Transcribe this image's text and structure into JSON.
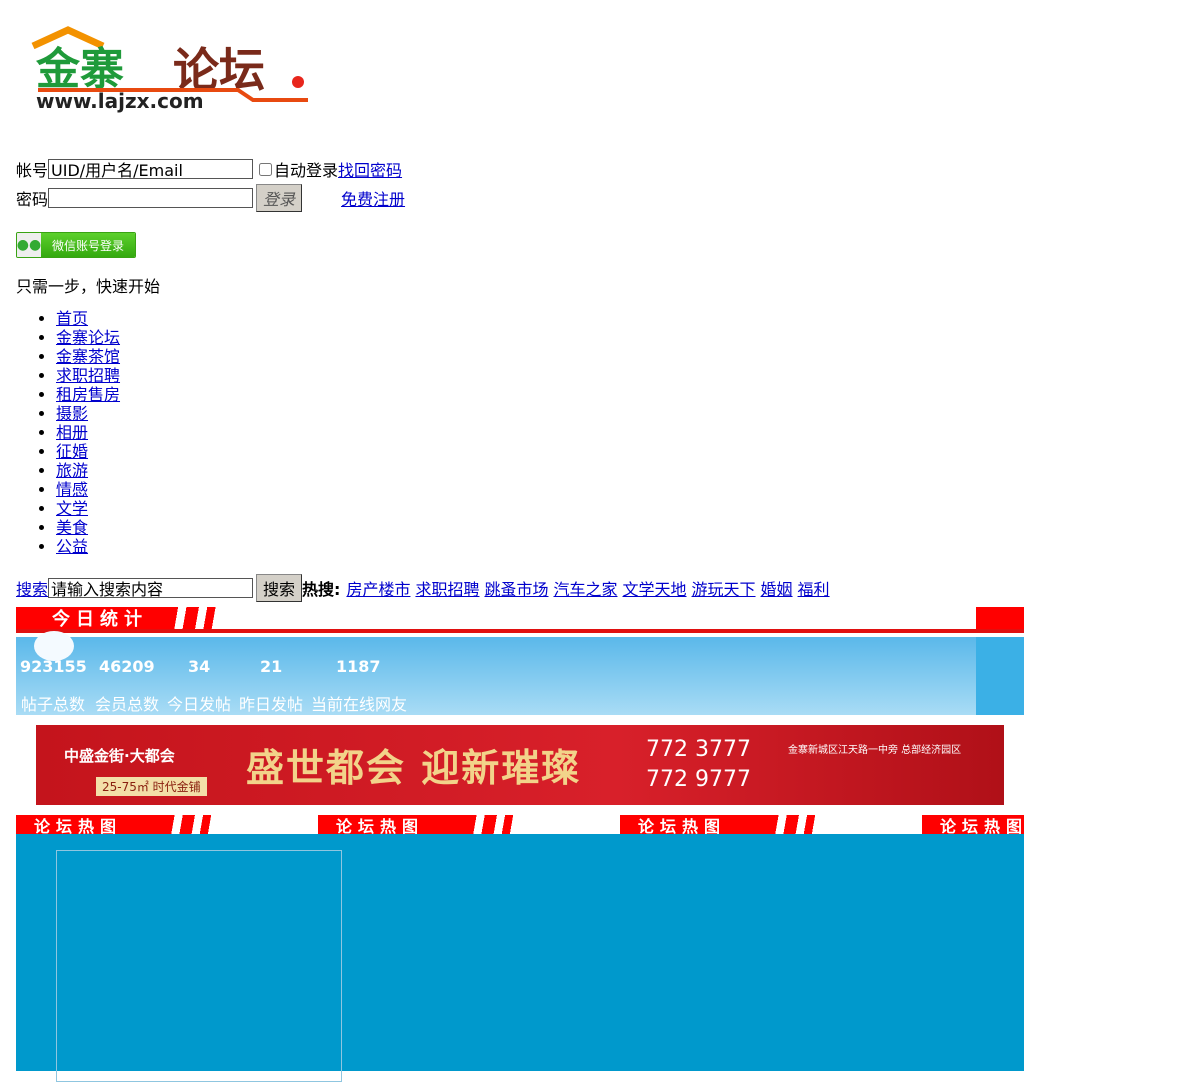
{
  "logo": {
    "title": "金寨论坛",
    "url_text": "www.lajzx.com"
  },
  "login": {
    "account_label": "帐号",
    "account_value": "UID/用户名/Email",
    "auto_login": "自动登录",
    "forgot": "找回密码",
    "password_label": "密码",
    "login_btn": "登录",
    "register": "免费注册",
    "wechat": "微信账号登录",
    "tagline": "只需一步，快速开始"
  },
  "nav": [
    "首页",
    "金寨论坛",
    "金寨茶馆",
    "求职招聘",
    "租房售房",
    "摄影",
    "相册",
    "征婚",
    "旅游",
    "情感",
    "文学",
    "美食",
    "公益"
  ],
  "search": {
    "label": "搜索",
    "value": "请输入搜索内容",
    "button": "搜索",
    "hot_label": "热搜:",
    "hot": [
      "房产楼市",
      "求职招聘",
      "跳蚤市场",
      "汽车之家",
      "文学天地",
      "游玩天下",
      "婚姻",
      "福利"
    ]
  },
  "stats": {
    "title": "今日统计",
    "items": [
      {
        "value": "923155",
        "label": "帖子总数"
      },
      {
        "value": "46209",
        "label": "会员总数"
      },
      {
        "value": "34",
        "label": "今日发帖"
      },
      {
        "value": "21",
        "label": "昨日发帖"
      },
      {
        "value": "1187",
        "label": "当前在线网友"
      }
    ]
  },
  "ad": {
    "brand": "中盛金街·大都会",
    "size": "25-75㎡ 时代金铺",
    "slogan": "盛世都会 迎新璀璨",
    "phone1": "772 3777",
    "phone2": "772 9777",
    "address": "金寨新城区江天路一中旁 总部经济园区"
  },
  "hot_title": "论坛热图"
}
